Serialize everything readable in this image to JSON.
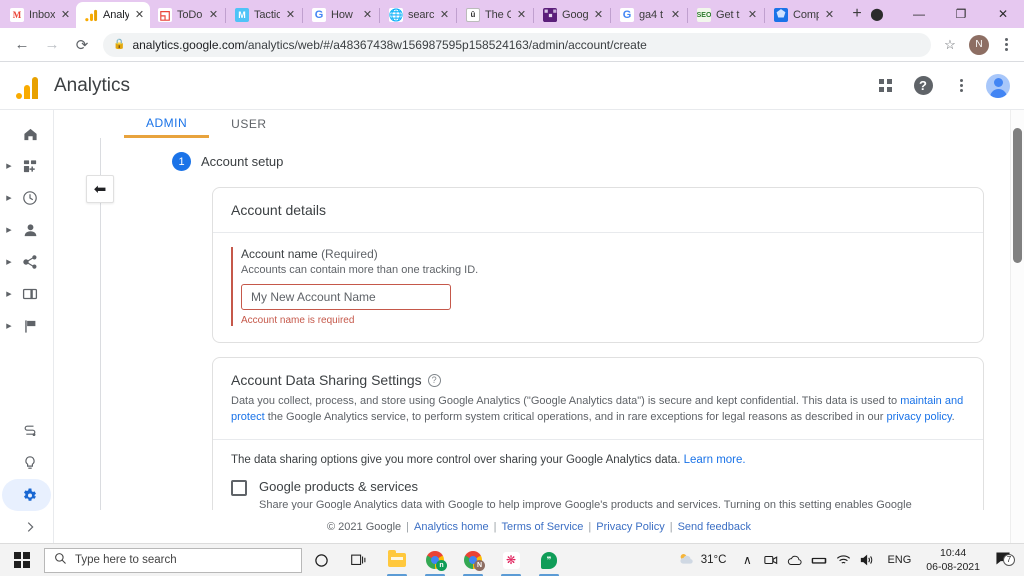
{
  "browser": {
    "tabs": [
      {
        "title": "Inbox",
        "favicon": "gmail-icon",
        "active": false
      },
      {
        "title": "Analy",
        "favicon": "analytics-icon",
        "active": true
      },
      {
        "title": "ToDo",
        "favicon": "todo-icon",
        "active": false
      },
      {
        "title": "Tactic",
        "favicon": "mail-icon",
        "active": false
      },
      {
        "title": "How",
        "favicon": "google-icon",
        "active": false
      },
      {
        "title": "searc",
        "favicon": "globe-icon",
        "active": false
      },
      {
        "title": "The C",
        "favicon": "u-icon",
        "active": false
      },
      {
        "title": "Goog",
        "favicon": "sheet-icon",
        "active": false
      },
      {
        "title": "ga4 t",
        "favicon": "google-icon",
        "active": false
      },
      {
        "title": "Get t",
        "favicon": "seo-icon",
        "active": false
      },
      {
        "title": "Comp",
        "favicon": "shield-icon",
        "active": false
      }
    ],
    "new_tab_label": "+",
    "window_controls": {
      "minimize": "—",
      "maximize": "❐",
      "close": "✕",
      "record": "⬤"
    },
    "nav": {
      "back": "←",
      "forward": "→",
      "reload": "⟳"
    },
    "url_host": "analytics.google.com",
    "url_path": "/analytics/web/#/a48367438w156987595p158524163/admin/account/create",
    "lock_icon": "lock-icon",
    "bookmark_icon": "star-icon",
    "profile_initial": "N",
    "menu_icon": "kebab-menu-icon"
  },
  "app": {
    "title": "Analytics",
    "logo_icon": "google-analytics-logo",
    "header_icons": {
      "apps": "apps-grid-icon",
      "help": "help-icon",
      "more": "more-vertical-icon",
      "account": "account-avatar-icon"
    },
    "rail": [
      {
        "name": "home",
        "icon": "home-icon",
        "expandable": false,
        "active": false
      },
      {
        "name": "realtime-customization",
        "icon": "dashboard-add-icon",
        "expandable": true,
        "active": false
      },
      {
        "name": "realtime",
        "icon": "clock-icon",
        "expandable": true,
        "active": false
      },
      {
        "name": "audience",
        "icon": "person-icon",
        "expandable": true,
        "active": false
      },
      {
        "name": "acquisition",
        "icon": "share-nodes-icon",
        "expandable": true,
        "active": false
      },
      {
        "name": "behavior",
        "icon": "window-icon",
        "expandable": true,
        "active": false
      },
      {
        "name": "conversions",
        "icon": "flag-icon",
        "expandable": true,
        "active": false
      },
      {
        "name": "attribution",
        "icon": "path-icon",
        "expandable": false,
        "active": false
      },
      {
        "name": "discover",
        "icon": "lightbulb-icon",
        "expandable": false,
        "active": false
      },
      {
        "name": "admin",
        "icon": "gear-icon",
        "expandable": false,
        "active": true
      },
      {
        "name": "expand-menu",
        "icon": "chevron-right-icon",
        "expandable": false,
        "active": false
      }
    ],
    "tabs": [
      {
        "label": "ADMIN",
        "active": true
      },
      {
        "label": "USER",
        "active": false
      }
    ],
    "back_button_icon": "back-arrow-icon"
  },
  "setup": {
    "step_number": "1",
    "step_title": "Account setup",
    "account_details": {
      "card_title": "Account details",
      "field_label": "Account name",
      "field_required_suffix": "(Required)",
      "field_help": "Accounts can contain more than one tracking ID.",
      "input_value": "My New Account Name",
      "input_placeholder": "My New Account Name",
      "error_text": "Account name is required"
    },
    "data_sharing": {
      "title": "Account Data Sharing Settings",
      "help_icon": "question-mark-icon",
      "paragraph_part1": "Data you collect, process, and store using Google Analytics (\"Google Analytics data\") is secure and kept confidential. This data is used to ",
      "link1": "maintain and protect",
      "paragraph_part2": " the Google Analytics service, to perform system critical operations, and in rare exceptions for legal reasons as described in our ",
      "link2": "privacy policy",
      "paragraph_part3": ".",
      "options_intro": "The data sharing options give you more control over sharing your Google Analytics data. ",
      "options_intro_link": "Learn more.",
      "options": [
        {
          "name": "Google products & services",
          "checked": false,
          "description": "Share your Google Analytics data with Google to help improve Google's products and services. Turning on this setting enables Google"
        }
      ]
    }
  },
  "footer": {
    "copyright": "© 2021 Google",
    "links": [
      "Analytics home",
      "Terms of Service",
      "Privacy Policy",
      "Send feedback"
    ],
    "separator": "|"
  },
  "taskbar": {
    "start_icon": "windows-start-icon",
    "search_placeholder": "Type here to search",
    "search_icon": "search-icon",
    "items": [
      {
        "name": "cortana",
        "icon": "circle-icon"
      },
      {
        "name": "task-view",
        "icon": "task-view-icon"
      },
      {
        "name": "file-explorer",
        "icon": "folder-icon"
      },
      {
        "name": "chrome-1",
        "icon": "chrome-icon",
        "badge": "n",
        "badge_color": "#0f9d58",
        "running": true
      },
      {
        "name": "chrome-2",
        "icon": "chrome-icon",
        "badge": "N",
        "badge_color": "#8d6e63",
        "running": true
      },
      {
        "name": "slack",
        "icon": "slack-icon",
        "running": true
      },
      {
        "name": "hangouts",
        "icon": "hangouts-icon",
        "running": true
      }
    ],
    "tray": {
      "weather_icon": "partly-cloudy-icon",
      "temperature": "31°C",
      "chevron": "∧",
      "icons": [
        "meet-camera-icon",
        "onedrive-cloud-icon",
        "hardware-icon",
        "wifi-icon",
        "volume-icon"
      ],
      "language": "ENG",
      "time": "10:44",
      "date": "06-08-2021",
      "notification_icon": "notifications-icon",
      "notification_count": "7"
    }
  }
}
